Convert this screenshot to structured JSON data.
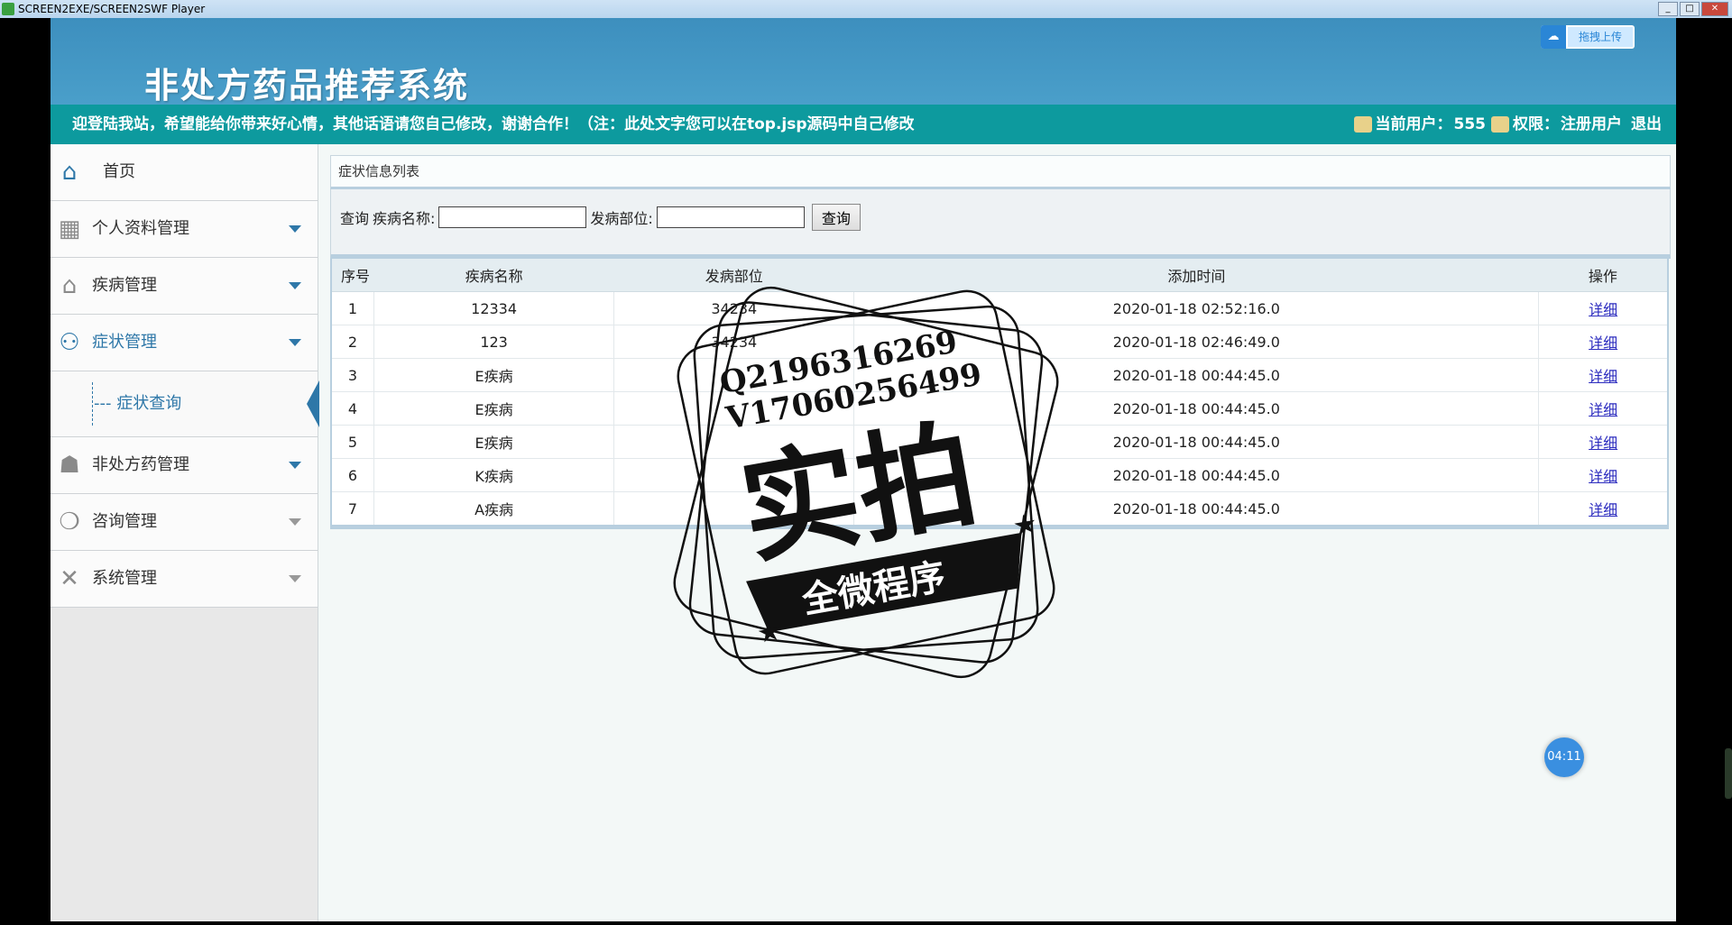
{
  "window": {
    "title": "SCREEN2EXE/SCREEN2SWF Player",
    "min": "_",
    "max": "□",
    "close": "✕"
  },
  "header": {
    "title": "非处方药品推荐系统",
    "upload_label": "拖拽上传",
    "upload_icon": "cloud-icon"
  },
  "infobar": {
    "welcome": "迎登陆我站，希望能给你带来好心情，其他话语请您自己修改，谢谢合作！（注：此处文字您可以在top.jsp源码中自己修改",
    "current_user_label": "当前用户：",
    "current_user": "555",
    "role_label": "权限：",
    "role": "注册用户",
    "logout": "退出"
  },
  "sidebar": {
    "items": [
      {
        "label": "首页",
        "icon": "home-icon"
      },
      {
        "label": "个人资料管理",
        "icon": "grid-icon"
      },
      {
        "label": "疾病管理",
        "icon": "house-icon"
      },
      {
        "label": "症状管理",
        "icon": "users-icon"
      },
      {
        "label": "非处方药管理",
        "icon": "person-icon"
      },
      {
        "label": "咨询管理",
        "icon": "chat-icon"
      },
      {
        "label": "系统管理",
        "icon": "tools-icon"
      }
    ],
    "submenu": {
      "label": "--- 症状查询"
    }
  },
  "panel": {
    "title": "症状信息列表"
  },
  "search": {
    "query_label": "查询",
    "disease_label": "疾病名称:",
    "disease_value": "",
    "site_label": "发病部位:",
    "site_value": "",
    "button": "查询"
  },
  "table": {
    "headers": [
      "序号",
      "疾病名称",
      "发病部位",
      "添加时间",
      "操作"
    ],
    "rows": [
      {
        "no": "1",
        "name": "12334",
        "site": "34234",
        "time": "2020-01-18 02:52:16.0",
        "op": "详细"
      },
      {
        "no": "2",
        "name": "123",
        "site": "34234",
        "time": "2020-01-18 02:46:49.0",
        "op": "详细"
      },
      {
        "no": "3",
        "name": "E疾病",
        "site": "",
        "time": "2020-01-18 00:44:45.0",
        "op": "详细"
      },
      {
        "no": "4",
        "name": "E疾病",
        "site": "",
        "time": "2020-01-18 00:44:45.0",
        "op": "详细"
      },
      {
        "no": "5",
        "name": "E疾病",
        "site": "",
        "time": "2020-01-18 00:44:45.0",
        "op": "详细"
      },
      {
        "no": "6",
        "name": "K疾病",
        "site": "",
        "time": "2020-01-18 00:44:45.0",
        "op": "详细"
      },
      {
        "no": "7",
        "name": "A疾病",
        "site": "",
        "time": "2020-01-18 00:44:45.0",
        "op": "详细"
      }
    ]
  },
  "watermark": {
    "line1": "Q2196316269",
    "line2": "V17060256499",
    "big": "实拍",
    "banner": "全微程序"
  },
  "timer": "04:11"
}
